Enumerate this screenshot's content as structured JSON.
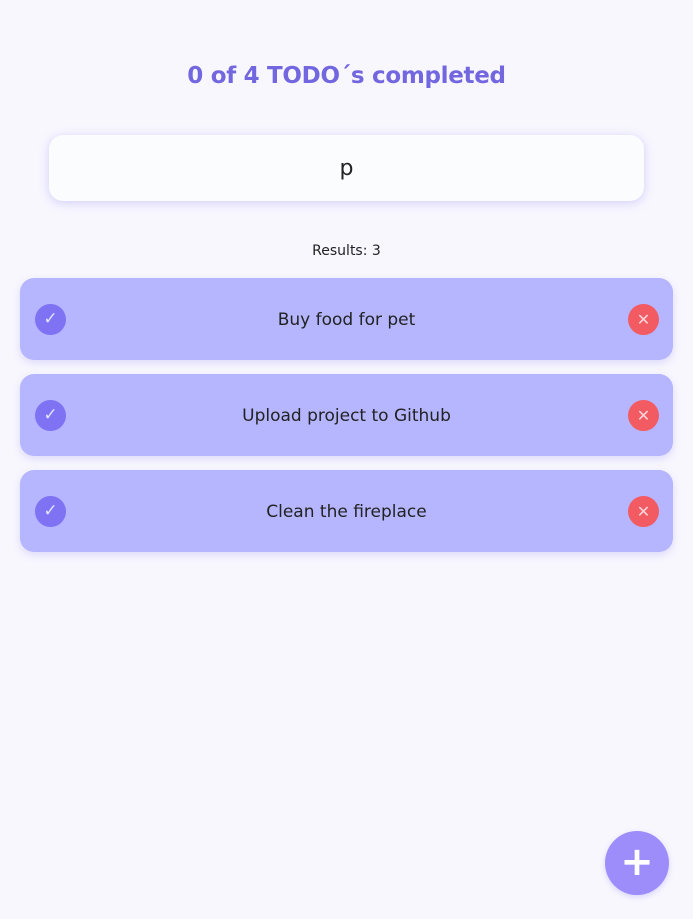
{
  "header": {
    "counter_text": "0 of 4 TODO´s completed"
  },
  "search": {
    "value": "p"
  },
  "results": {
    "text": "Results: 3"
  },
  "todos": [
    {
      "text": "Buy food for pet",
      "check_icon": "check-icon",
      "delete_icon": "close-icon"
    },
    {
      "text": "Upload project to Github",
      "check_icon": "check-icon",
      "delete_icon": "close-icon"
    },
    {
      "text": "Clean the fireplace",
      "check_icon": "check-icon",
      "delete_icon": "close-icon"
    }
  ],
  "fab": {
    "icon": "plus-icon"
  },
  "colors": {
    "background": "#f8f7fe",
    "accent": "#7367e0",
    "todo_card": "#b5b6ff",
    "check": "#7f72f3",
    "delete": "#f35b63",
    "fab": "#9d8dfb"
  }
}
